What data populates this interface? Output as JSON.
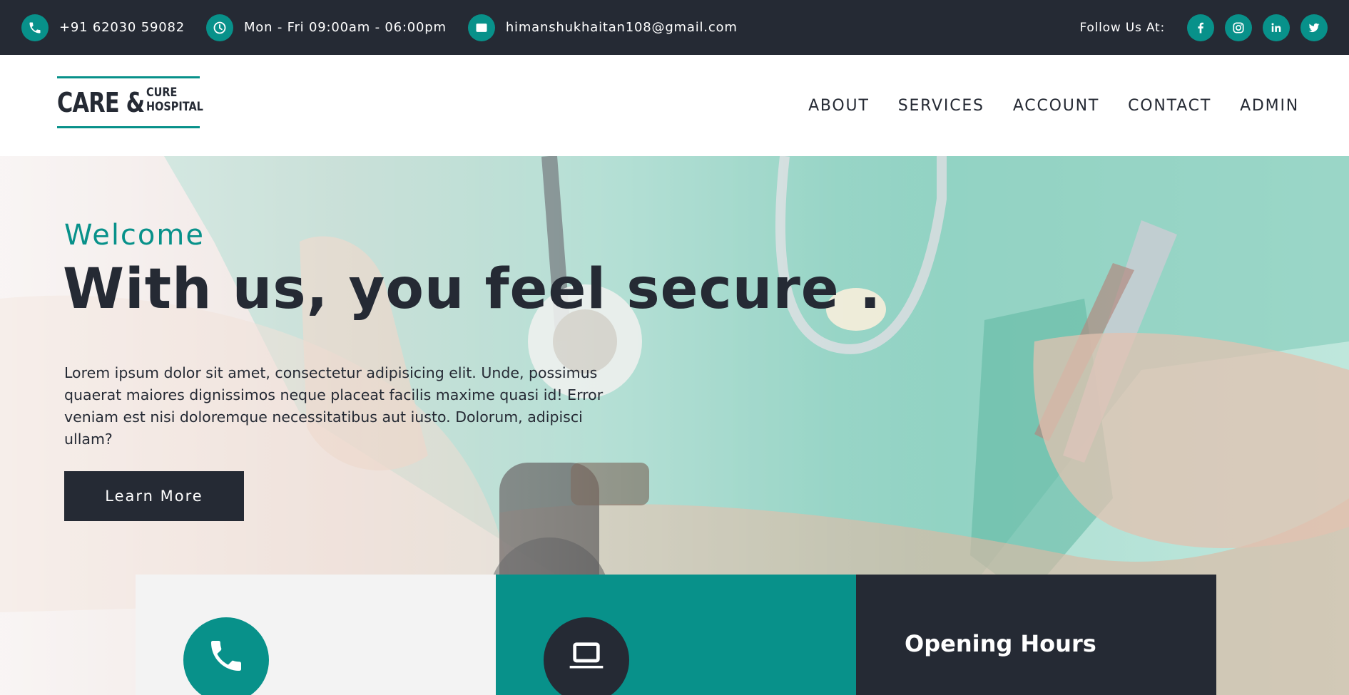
{
  "topbar": {
    "phone": "+91 62030 59082",
    "hours": "Mon - Fri 09:00am - 06:00pm",
    "email": "himanshukhaitan108@gmail.com",
    "follow_label": "Follow Us At:",
    "socials": [
      "facebook-icon",
      "instagram-icon",
      "linkedin-icon",
      "twitter-icon"
    ]
  },
  "logo": {
    "main": "CARE &",
    "sub_line1": "CURE",
    "sub_line2": "HOSPITAL"
  },
  "nav": {
    "items": [
      "ABOUT",
      "SERVICES",
      "ACCOUNT",
      "CONTACT",
      "ADMIN"
    ]
  },
  "hero": {
    "welcome": "Welcome",
    "headline": "With us, you feel secure .",
    "lead": "Lorem ipsum dolor sit amet, consectetur adipisicing elit. Unde, possimus quaerat maiores dignissimos neque placeat facilis maxime quasi id! Error veniam est nisi doloremque necessitatibus aut iusto. Dolorum, adipisci ullam?",
    "button": "Learn More"
  },
  "cards": {
    "card1_icon": "phone-icon",
    "card2_icon": "laptop-icon",
    "card3_title": "Opening Hours"
  },
  "colors": {
    "dark": "#252a34",
    "accent": "#08918a",
    "light": "#f3f3f3"
  }
}
